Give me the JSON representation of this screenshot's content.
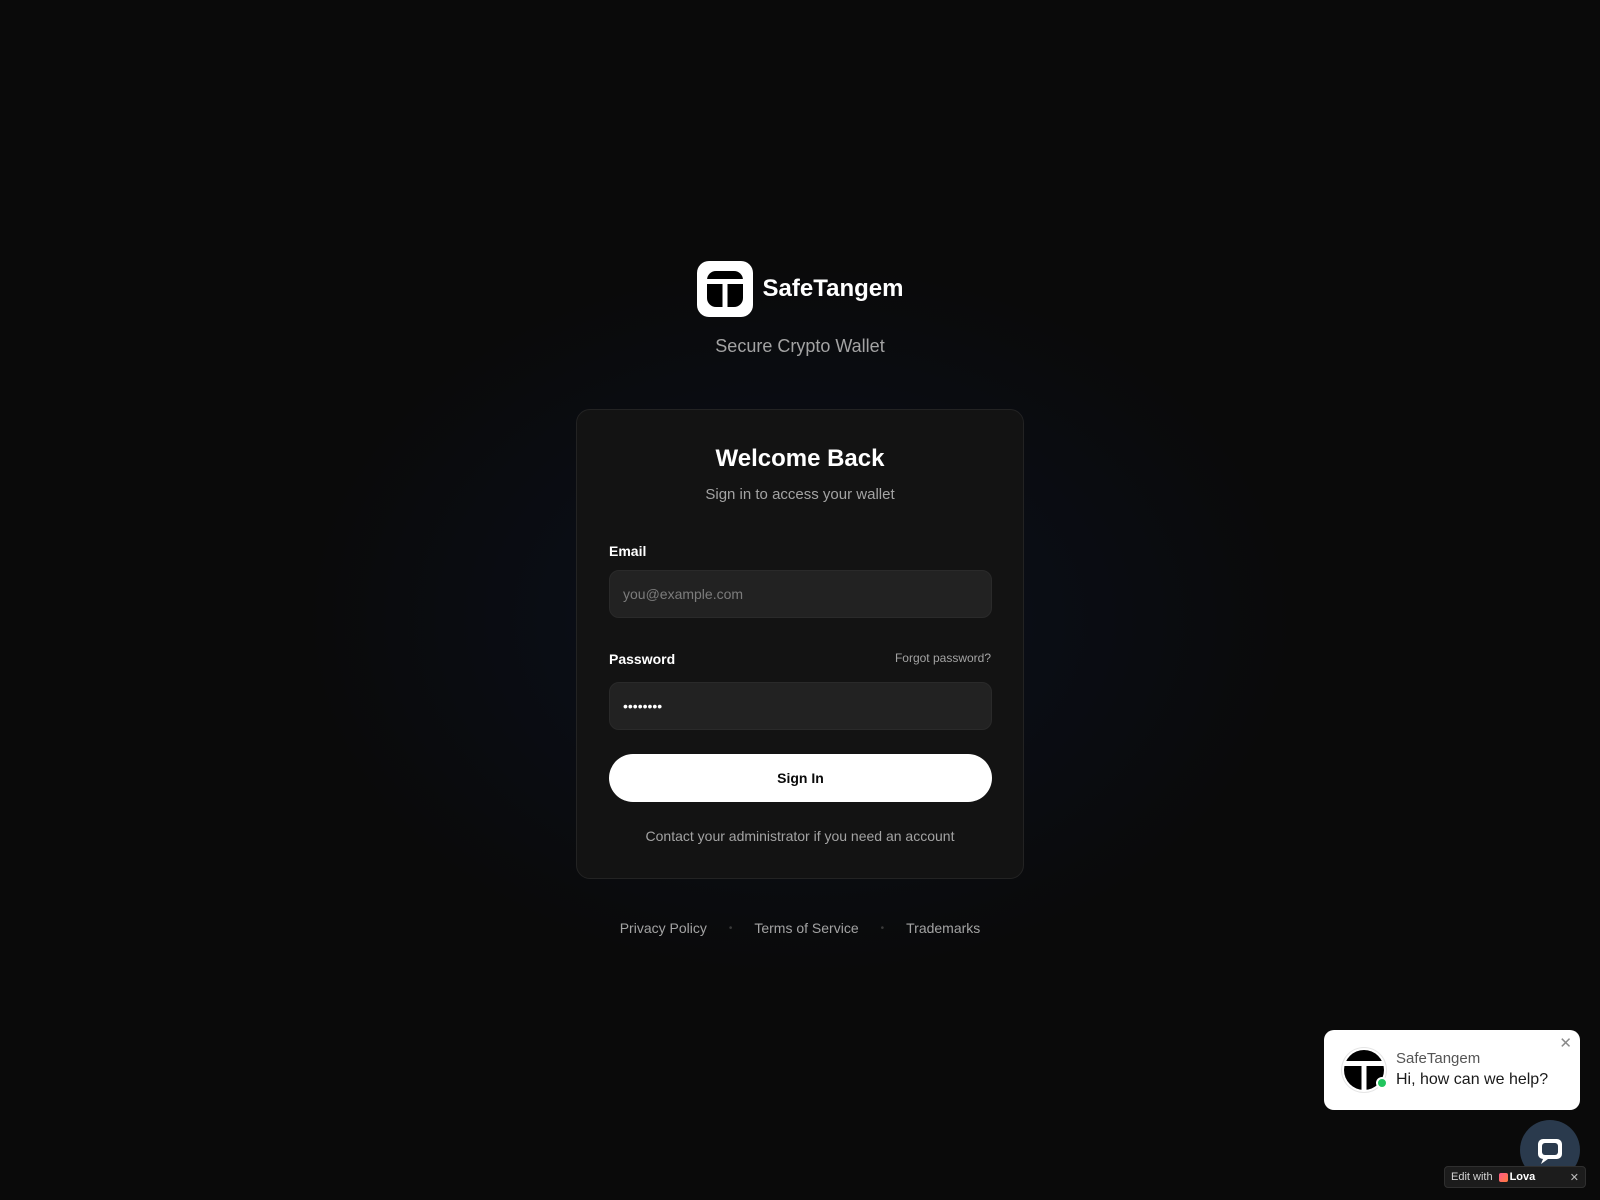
{
  "brand": {
    "name": "SafeTangem",
    "tagline": "Secure Crypto Wallet",
    "logo_icon": "tangem-t-logo-icon"
  },
  "card": {
    "title": "Welcome Back",
    "subtitle": "Sign in to access your wallet",
    "email_label": "Email",
    "email_placeholder": "you@example.com",
    "email_value": "",
    "password_label": "Password",
    "password_value": "••••••••",
    "forgot_label": "Forgot password?",
    "signin_label": "Sign In",
    "contact_text": "Contact your administrator if you need an account"
  },
  "footer": {
    "links": [
      "Privacy Policy",
      "Terms of Service",
      "Trademarks"
    ],
    "separator": "•"
  },
  "chat": {
    "name": "SafeTangem",
    "message": "Hi, how can we help?",
    "close_icon": "close-icon",
    "status_color": "#22c55e",
    "launcher_icon": "chat-icon"
  },
  "edit_badge": {
    "prefix": "Edit with",
    "brand": "Lova",
    "close": "✕"
  },
  "colors": {
    "background": "#0a0a0a",
    "card": "#131313",
    "input": "#222222",
    "primary_button": "#ffffff",
    "muted_text": "#a3a3a3"
  }
}
